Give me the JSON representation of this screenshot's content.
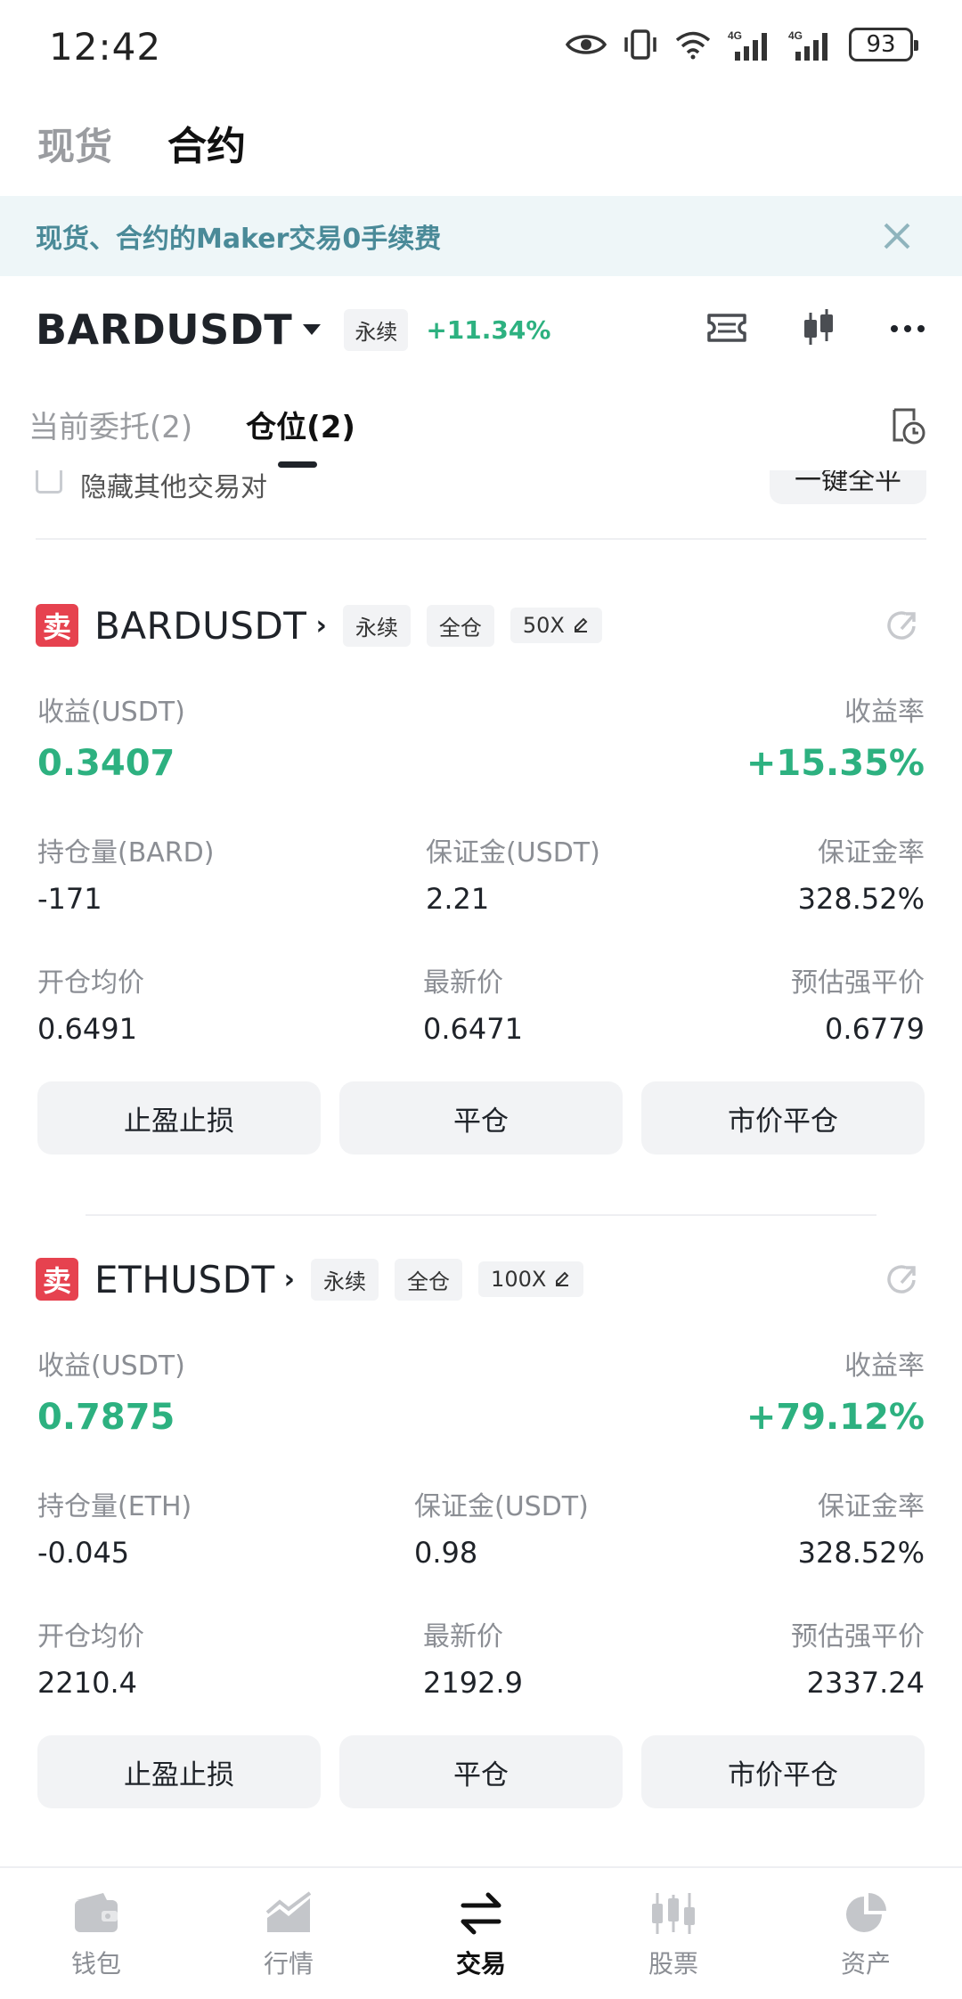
{
  "status_bar": {
    "time": "12:42",
    "network_1": "4G",
    "network_2": "4G",
    "battery": "93",
    "icons": [
      "eye-icon",
      "vibrate-icon",
      "wifi-icon",
      "signal-icon",
      "signal-icon",
      "battery-icon"
    ]
  },
  "top_tabs": [
    {
      "label": "现货",
      "active": false
    },
    {
      "label": "合约",
      "active": true
    }
  ],
  "banner": {
    "text": "现货、合约的Maker交易0手续费",
    "close_icon": "close-icon"
  },
  "symbol_header": {
    "symbol": "BARDUSDT",
    "type_badge": "永续",
    "change": "+11.34%",
    "icons": [
      "ticket-icon",
      "candlestick-icon",
      "more-icon"
    ]
  },
  "order_tabs": [
    {
      "label": "当前委托(2)",
      "active": false
    },
    {
      "label": "仓位(2)",
      "active": true
    }
  ],
  "filter_row": {
    "checkbox_label": "隐藏其他交易对",
    "close_all_button": "一键全平"
  },
  "positions": [
    {
      "side": "卖",
      "symbol": "BARDUSDT",
      "type": "永续",
      "margin_mode": "全仓",
      "leverage": "50X",
      "pnl_label": "收益(USDT)",
      "pnl": "0.3407",
      "roe_label": "收益率",
      "roe": "+15.35%",
      "size_label": "持仓量(BARD)",
      "size": "-171",
      "margin_label": "保证金(USDT)",
      "margin": "2.21",
      "margin_ratio_label": "保证金率",
      "margin_ratio": "328.52%",
      "entry_label": "开仓均价",
      "entry": "0.6491",
      "last_label": "最新价",
      "last": "0.6471",
      "liq_label": "预估强平价",
      "liq": "0.6779",
      "buttons": [
        "止盈止损",
        "平仓",
        "市价平仓"
      ]
    },
    {
      "side": "卖",
      "symbol": "ETHUSDT",
      "type": "永续",
      "margin_mode": "全仓",
      "leverage": "100X",
      "pnl_label": "收益(USDT)",
      "pnl": "0.7875",
      "roe_label": "收益率",
      "roe": "+79.12%",
      "size_label": "持仓量(ETH)",
      "size": "-0.045",
      "margin_label": "保证金(USDT)",
      "margin": "0.98",
      "margin_ratio_label": "保证金率",
      "margin_ratio": "328.52%",
      "entry_label": "开仓均价",
      "entry": "2210.4",
      "last_label": "最新价",
      "last": "2192.9",
      "liq_label": "预估强平价",
      "liq": "2337.24",
      "buttons": [
        "止盈止损",
        "平仓",
        "市价平仓"
      ]
    }
  ],
  "bottom_nav": [
    {
      "label": "钱包",
      "icon": "wallet-icon",
      "active": false
    },
    {
      "label": "行情",
      "icon": "market-chart-icon",
      "active": false
    },
    {
      "label": "交易",
      "icon": "trade-swap-icon",
      "active": true
    },
    {
      "label": "股票",
      "icon": "stocks-icon",
      "active": false
    },
    {
      "label": "资产",
      "icon": "assets-pie-icon",
      "active": false
    }
  ],
  "colors": {
    "positive": "#2db180",
    "sell": "#e6424f",
    "banner_bg": "#eef6f8",
    "banner_text": "#4a8a98"
  }
}
